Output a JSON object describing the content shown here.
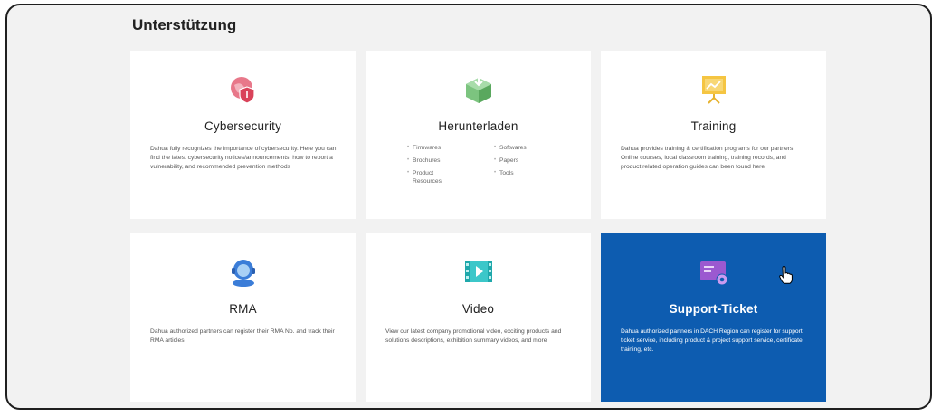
{
  "page": {
    "title": "Unterstützung"
  },
  "cards": [
    {
      "title": "Cybersecurity",
      "icon": "shield-globe-icon",
      "description": "Dahua fully recognizes the importance of cybersecurity. Here you can find the latest cybersecurity notices/announcements, how to report a vulnerability, and recommended prevention methods"
    },
    {
      "title": "Herunterladen",
      "icon": "download-box-icon",
      "links": [
        "Firmwares",
        "Softwares",
        "Brochures",
        "Papers",
        "Product Resources",
        "Tools"
      ]
    },
    {
      "title": "Training",
      "icon": "presentation-board-icon",
      "description": "Dahua provides training & certification programs for our partners. Online courses, local classroom training, training records, and product related operation guides can been found here"
    },
    {
      "title": "RMA",
      "icon": "headset-agent-icon",
      "description": "Dahua authorized partners can register their RMA No. and track their RMA articles"
    },
    {
      "title": "Video",
      "icon": "video-play-icon",
      "description": "View our latest company promotional video, exciting products and solutions descriptions, exhibition summary videos, and more"
    },
    {
      "title": "Support-Ticket",
      "icon": "ticket-gear-icon",
      "description": "Dahua authorized partners in DACH Region can register for support ticket service, including product & project support service, certificate training, etc."
    }
  ],
  "colors": {
    "active_card": "#0d5cb0",
    "background": "#f2f2f2",
    "card": "#ffffff"
  }
}
